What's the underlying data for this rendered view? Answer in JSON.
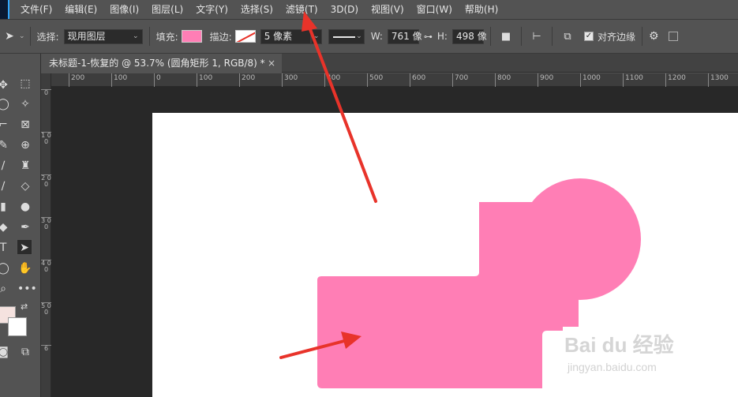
{
  "menu": [
    "文件(F)",
    "编辑(E)",
    "图像(I)",
    "图层(L)",
    "文字(Y)",
    "选择(S)",
    "滤镜(T)",
    "3D(D)",
    "视图(V)",
    "窗口(W)",
    "帮助(H)"
  ],
  "options": {
    "select_label": "选择:",
    "select_value": "现用图层",
    "fill_label": "填充:",
    "fill_color": "#ff7eb5",
    "stroke_label": "描边:",
    "stroke_width": "5 像素",
    "w_label": "W:",
    "w_value": "761 像",
    "h_label": "H:",
    "h_value": "498 像",
    "align_edges_label": "对齐边缘"
  },
  "document": {
    "tab_title": "未标题-1-恢复的 @ 53.7% (圆角矩形 1, RGB/8) *",
    "close": "×"
  },
  "ruler": {
    "h_ticks": [
      "200",
      "100",
      "0",
      "100",
      "200",
      "300",
      "400",
      "500",
      "600",
      "700",
      "800",
      "900",
      "1000",
      "1100",
      "1200",
      "1300"
    ],
    "v_ticks": [
      "0",
      "1 0 0",
      "2 0 0",
      "3 0 0",
      "4 0 0",
      "5 0 0",
      "6"
    ]
  },
  "shape": {
    "color": "#ff7eb5"
  },
  "annotation": {
    "arrow_color": "#e8332a"
  },
  "watermark": {
    "brand": "Bai du 经验",
    "url": "jingyan.baidu.com"
  }
}
